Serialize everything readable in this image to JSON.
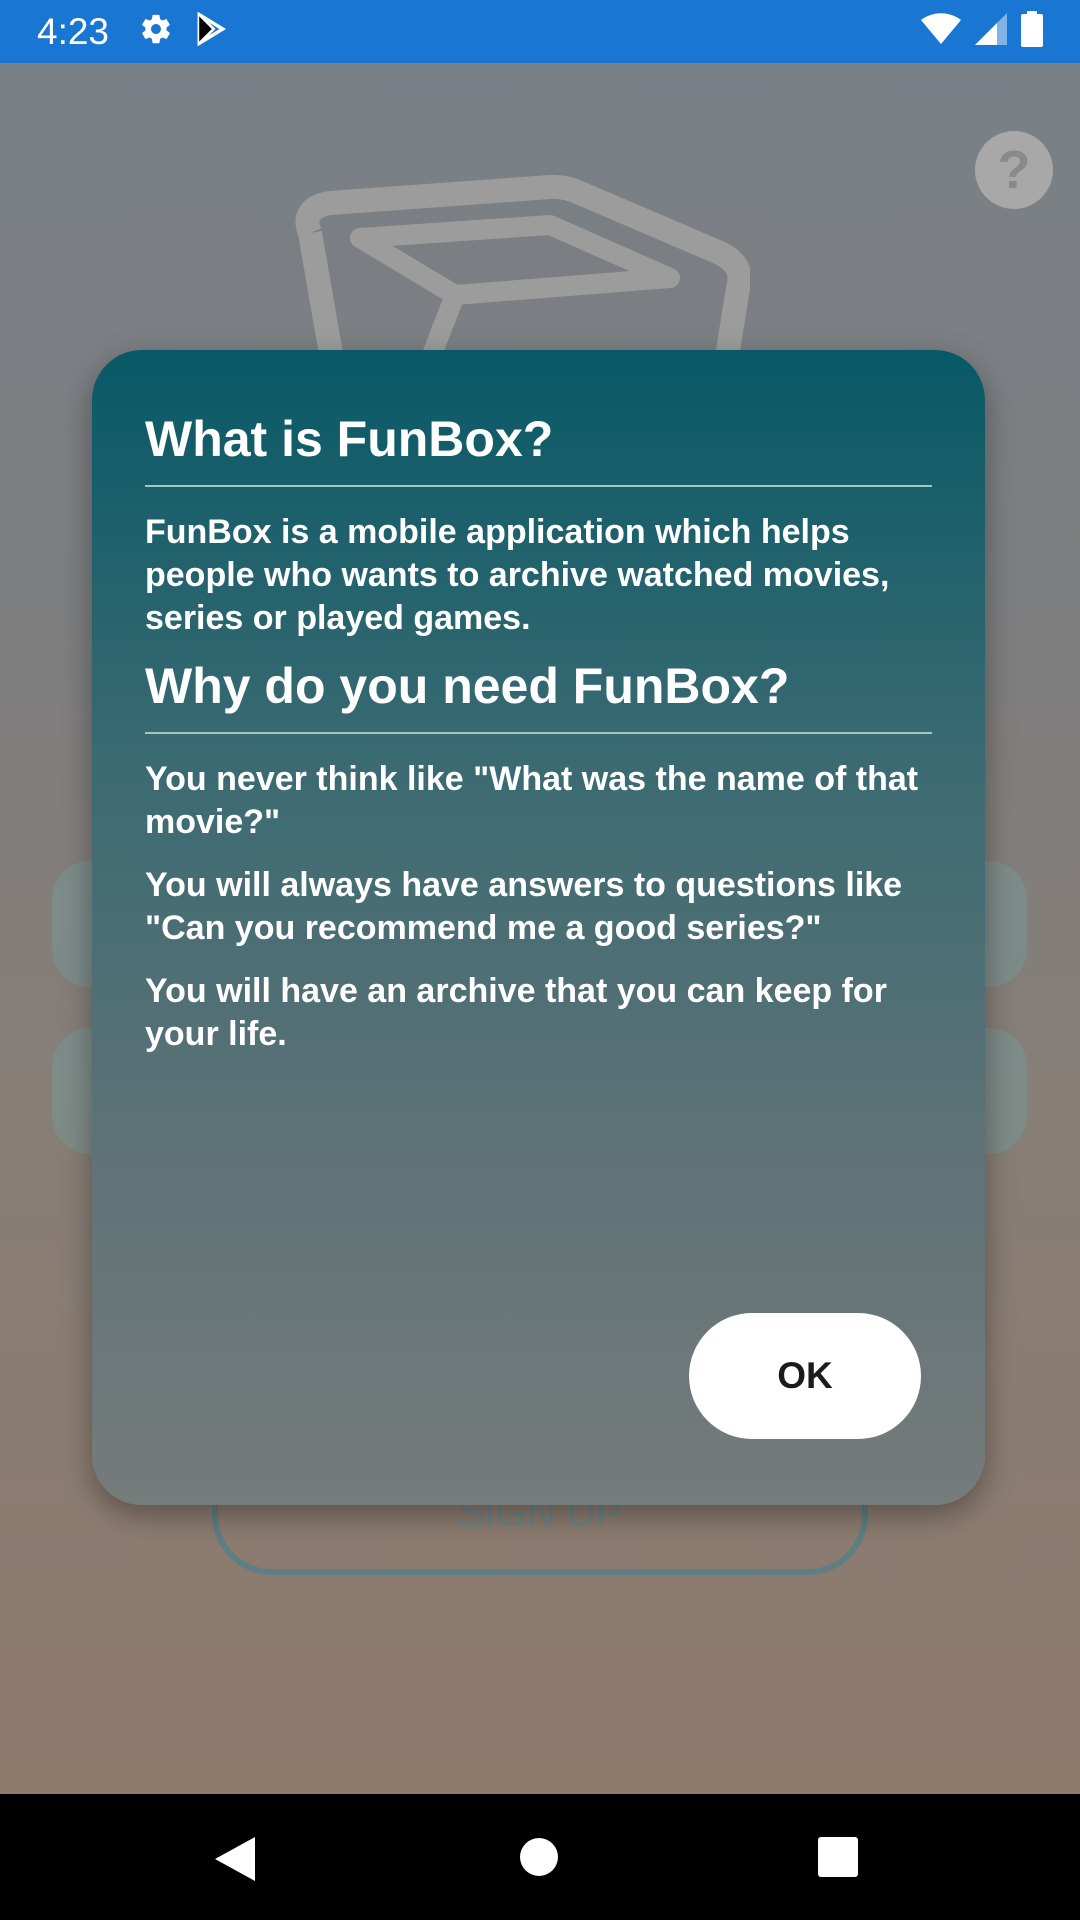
{
  "status_bar": {
    "time": "4:23",
    "icons": [
      "settings-icon",
      "play-store-icon",
      "wifi-icon",
      "signal-icon",
      "battery-icon"
    ],
    "background": "#1976d2"
  },
  "background_screen": {
    "help_label": "?",
    "signup_label": "SIGN UP"
  },
  "dialog": {
    "heading1": "What is FunBox?",
    "para1": "FunBox is a mobile application which helps people who wants to archive watched movies, series or played games.",
    "heading2": "Why do you need FunBox?",
    "para2": "You never think like \"What was the name of that movie?\"",
    "para3": "You will always have answers to questions like \"Can you recommend me a good series?\"",
    "para4": "You will have an archive that you can keep for your life.",
    "ok_label": "OK",
    "accent_top": "#075966"
  },
  "nav_bar": {
    "icons": [
      "back-icon",
      "home-icon",
      "recents-icon"
    ]
  }
}
